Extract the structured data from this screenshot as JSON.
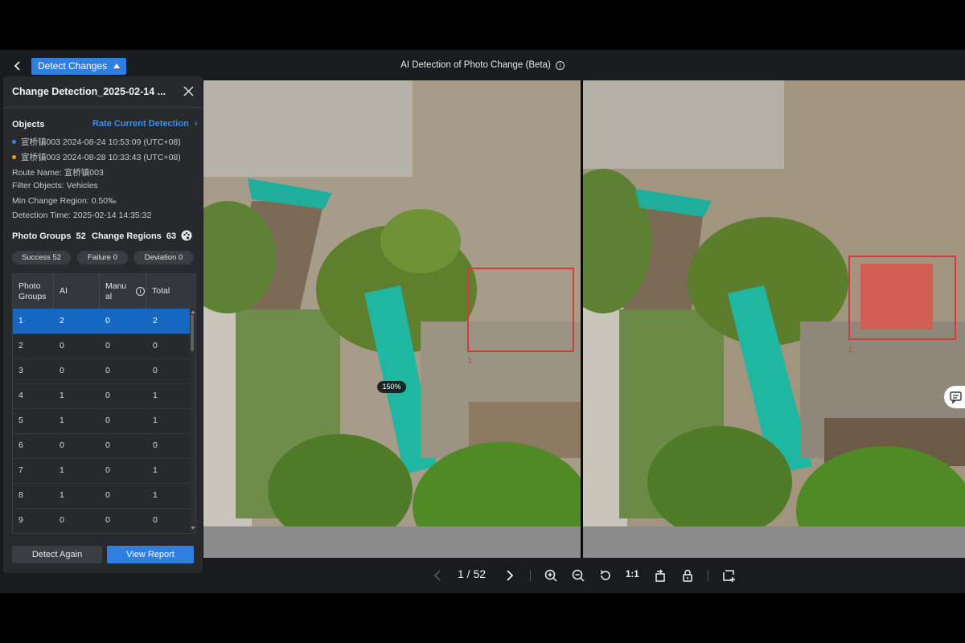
{
  "header": {
    "back_icon": "chevron-left-icon",
    "detect_button_label": "Detect Changes",
    "title": "AI Detection of Photo Change (Beta)"
  },
  "panel": {
    "title": "Change Detection_2025-02-14 ...",
    "objects_label": "Objects",
    "rate_link": "Rate Current Detection",
    "objects": [
      {
        "text": "宣桥镇003 2024-08-24 10:53:09 (UTC+08)",
        "color": "#3b82f6"
      },
      {
        "text": "宣桥镇003 2024-08-28 10:33:43 (UTC+08)",
        "color": "#f59e0b"
      }
    ],
    "route_name": "Route Name:  宣桥镇003",
    "filter_objects": "Filter Objects:  Vehicles",
    "min_change_region": "Min Change Region:  0.50‰",
    "detection_time": "Detection Time:  2025-02-14 14:35:32",
    "photo_groups_label": "Photo Groups",
    "photo_groups_count": "52",
    "change_regions_label": "Change Regions",
    "change_regions_count": "63",
    "pills": [
      "Success 52",
      "Failure 0",
      "Deviation 0"
    ],
    "table": {
      "headers": [
        "Photo Groups",
        "AI",
        "Manual",
        "Total"
      ],
      "rows": [
        [
          "1",
          "2",
          "0",
          "2"
        ],
        [
          "2",
          "0",
          "0",
          "0"
        ],
        [
          "3",
          "0",
          "0",
          "0"
        ],
        [
          "4",
          "1",
          "0",
          "1"
        ],
        [
          "5",
          "1",
          "0",
          "1"
        ],
        [
          "6",
          "0",
          "0",
          "0"
        ],
        [
          "7",
          "1",
          "0",
          "1"
        ],
        [
          "8",
          "1",
          "0",
          "1"
        ],
        [
          "9",
          "0",
          "0",
          "0"
        ]
      ]
    },
    "detect_again": "Detect Again",
    "view_report": "View Report"
  },
  "viewer": {
    "zoom_badge": "150%",
    "region_label_left": "1",
    "region_label_right": "1"
  },
  "toolbar": {
    "pager": "1 / 52",
    "one_to_one": "1:1"
  },
  "colors": {
    "accent": "#2f7ee0",
    "selected_row": "#1667c1",
    "region_box": "#d63a3a"
  }
}
